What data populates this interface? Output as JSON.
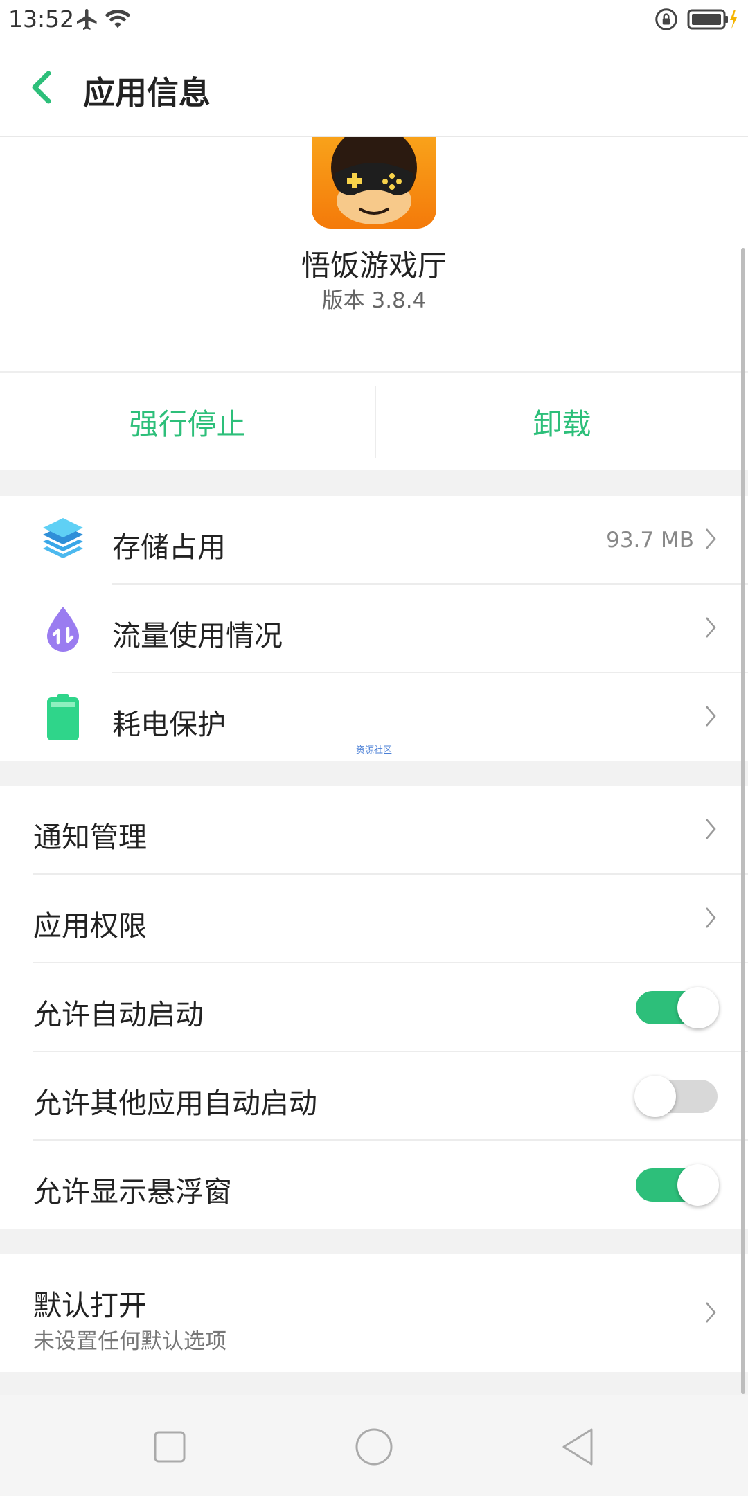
{
  "status_bar": {
    "time": "13:52",
    "icons": [
      "airplane-icon",
      "wifi-icon",
      "rotation-lock-icon",
      "battery-icon"
    ]
  },
  "header": {
    "title": "应用信息",
    "back_icon": "back-chevron-icon"
  },
  "app": {
    "name": "悟饭游戏厅",
    "version": "版本 3.8.4",
    "icon": "monkey-gamepad-icon"
  },
  "actions": {
    "force_stop": "强行停止",
    "uninstall": "卸载",
    "accent_color": "#2dbf7a"
  },
  "usage_section": {
    "items": [
      {
        "label": "存储占用",
        "value": "93.7 MB",
        "icon": "storage-layers-icon"
      },
      {
        "label": "流量使用情况",
        "value": "",
        "icon": "data-usage-drop-icon"
      },
      {
        "label": "耗电保护",
        "value": "",
        "icon": "battery-protect-icon"
      }
    ],
    "watermark": "资源社区"
  },
  "settings_section": {
    "items": [
      {
        "label": "通知管理",
        "type": "link"
      },
      {
        "label": "应用权限",
        "type": "link"
      },
      {
        "label": "允许自动启动",
        "type": "toggle",
        "enabled": true
      },
      {
        "label": "允许其他应用自动启动",
        "type": "toggle",
        "enabled": false
      },
      {
        "label": "允许显示悬浮窗",
        "type": "toggle",
        "enabled": true
      }
    ]
  },
  "default_open": {
    "label": "默认打开",
    "sublabel": "未设置任何默认选项"
  },
  "nav_bar": {
    "buttons": [
      "recents-square-icon",
      "home-circle-icon",
      "back-triangle-icon"
    ]
  }
}
